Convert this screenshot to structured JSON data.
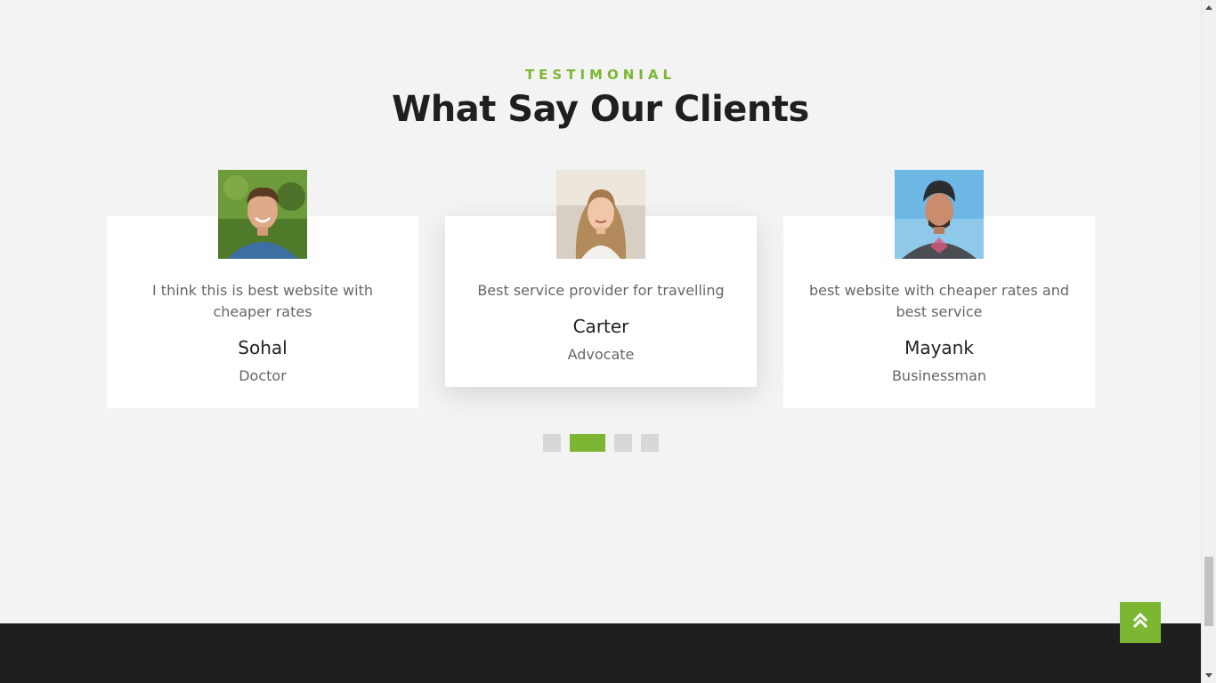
{
  "section": {
    "eyebrow": "TESTIMONIAL",
    "title": "What Say Our Clients"
  },
  "testimonials": [
    {
      "quote": "I think this is best website with cheaper rates",
      "name": "Sohal",
      "role": "Doctor"
    },
    {
      "quote": "Best service provider for travelling",
      "name": "Carter",
      "role": "Advocate"
    },
    {
      "quote": "best website with cheaper rates and best service",
      "name": "Mayank",
      "role": "Businessman"
    }
  ],
  "carousel": {
    "dot_count": 4,
    "active_index": 1
  },
  "colors": {
    "accent": "#7cb733",
    "background": "#f3f3f3",
    "footer": "#1f1f1f",
    "heading": "#1f1f1f",
    "body_text": "#666666"
  },
  "icons": {
    "back_to_top": "double-chevron-up-icon"
  }
}
